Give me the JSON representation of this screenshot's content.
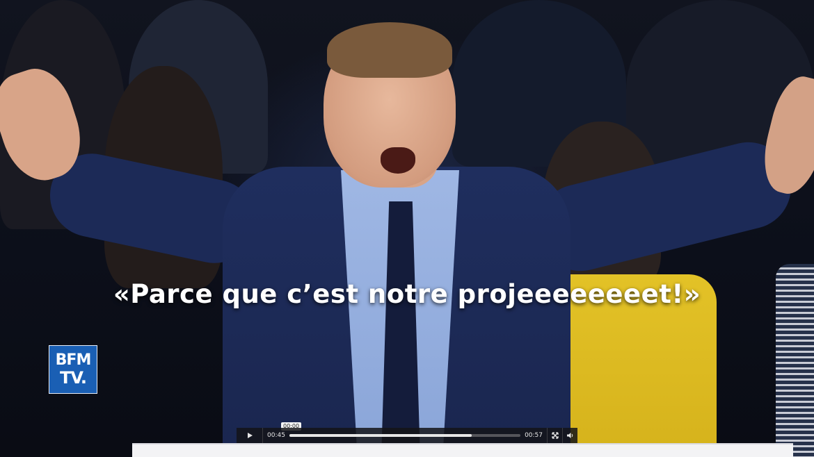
{
  "caption": {
    "text": "«Parce que c’est notre projeeeeeeeet!»"
  },
  "logo": {
    "line1": "BFM",
    "line2": "TV.",
    "color": "#1a5fb4"
  },
  "player": {
    "current_time": "00:45",
    "duration": "00:57",
    "hover_time": "00:00",
    "progress_fraction": 0.79,
    "play_icon": "play-icon",
    "fullscreen_icon": "fullscreen-icon",
    "volume_icon": "volume-icon"
  }
}
